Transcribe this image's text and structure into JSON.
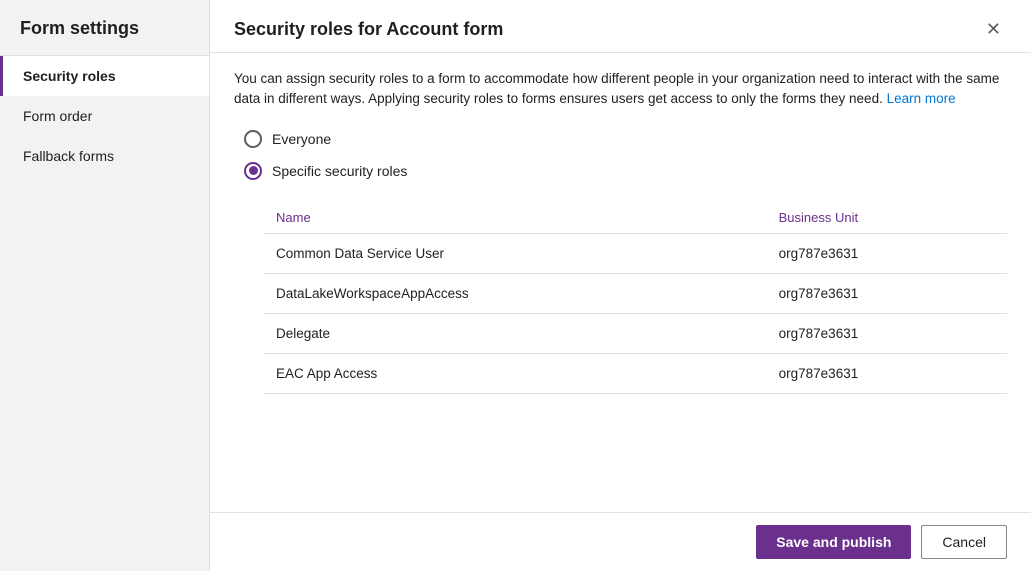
{
  "sidebar": {
    "title": "Form settings",
    "items": [
      {
        "id": "security-roles",
        "label": "Security roles",
        "active": true
      },
      {
        "id": "form-order",
        "label": "Form order",
        "active": false
      },
      {
        "id": "fallback-forms",
        "label": "Fallback forms",
        "active": false
      }
    ]
  },
  "dialog": {
    "title": "Security roles for Account form",
    "close_icon": "✕",
    "description_part1": "You can assign security roles to a form to accommodate how different people in your organization need to interact with the same data in different ways. Applying security roles to forms ensures users get access to only the forms they need.",
    "learn_more_label": "Learn more",
    "learn_more_url": "#",
    "radio_options": [
      {
        "id": "everyone",
        "label": "Everyone",
        "selected": false
      },
      {
        "id": "specific",
        "label": "Specific security roles",
        "selected": true
      }
    ],
    "table": {
      "columns": [
        {
          "id": "name",
          "label": "Name"
        },
        {
          "id": "business_unit",
          "label": "Business Unit"
        }
      ],
      "rows": [
        {
          "name": "Common Data Service User",
          "business_unit": "org787e3631"
        },
        {
          "name": "DataLakeWorkspaceAppAccess",
          "business_unit": "org787e3631"
        },
        {
          "name": "Delegate",
          "business_unit": "org787e3631"
        },
        {
          "name": "EAC App Access",
          "business_unit": "org787e3631"
        }
      ]
    }
  },
  "footer": {
    "save_label": "Save and publish",
    "cancel_label": "Cancel"
  }
}
